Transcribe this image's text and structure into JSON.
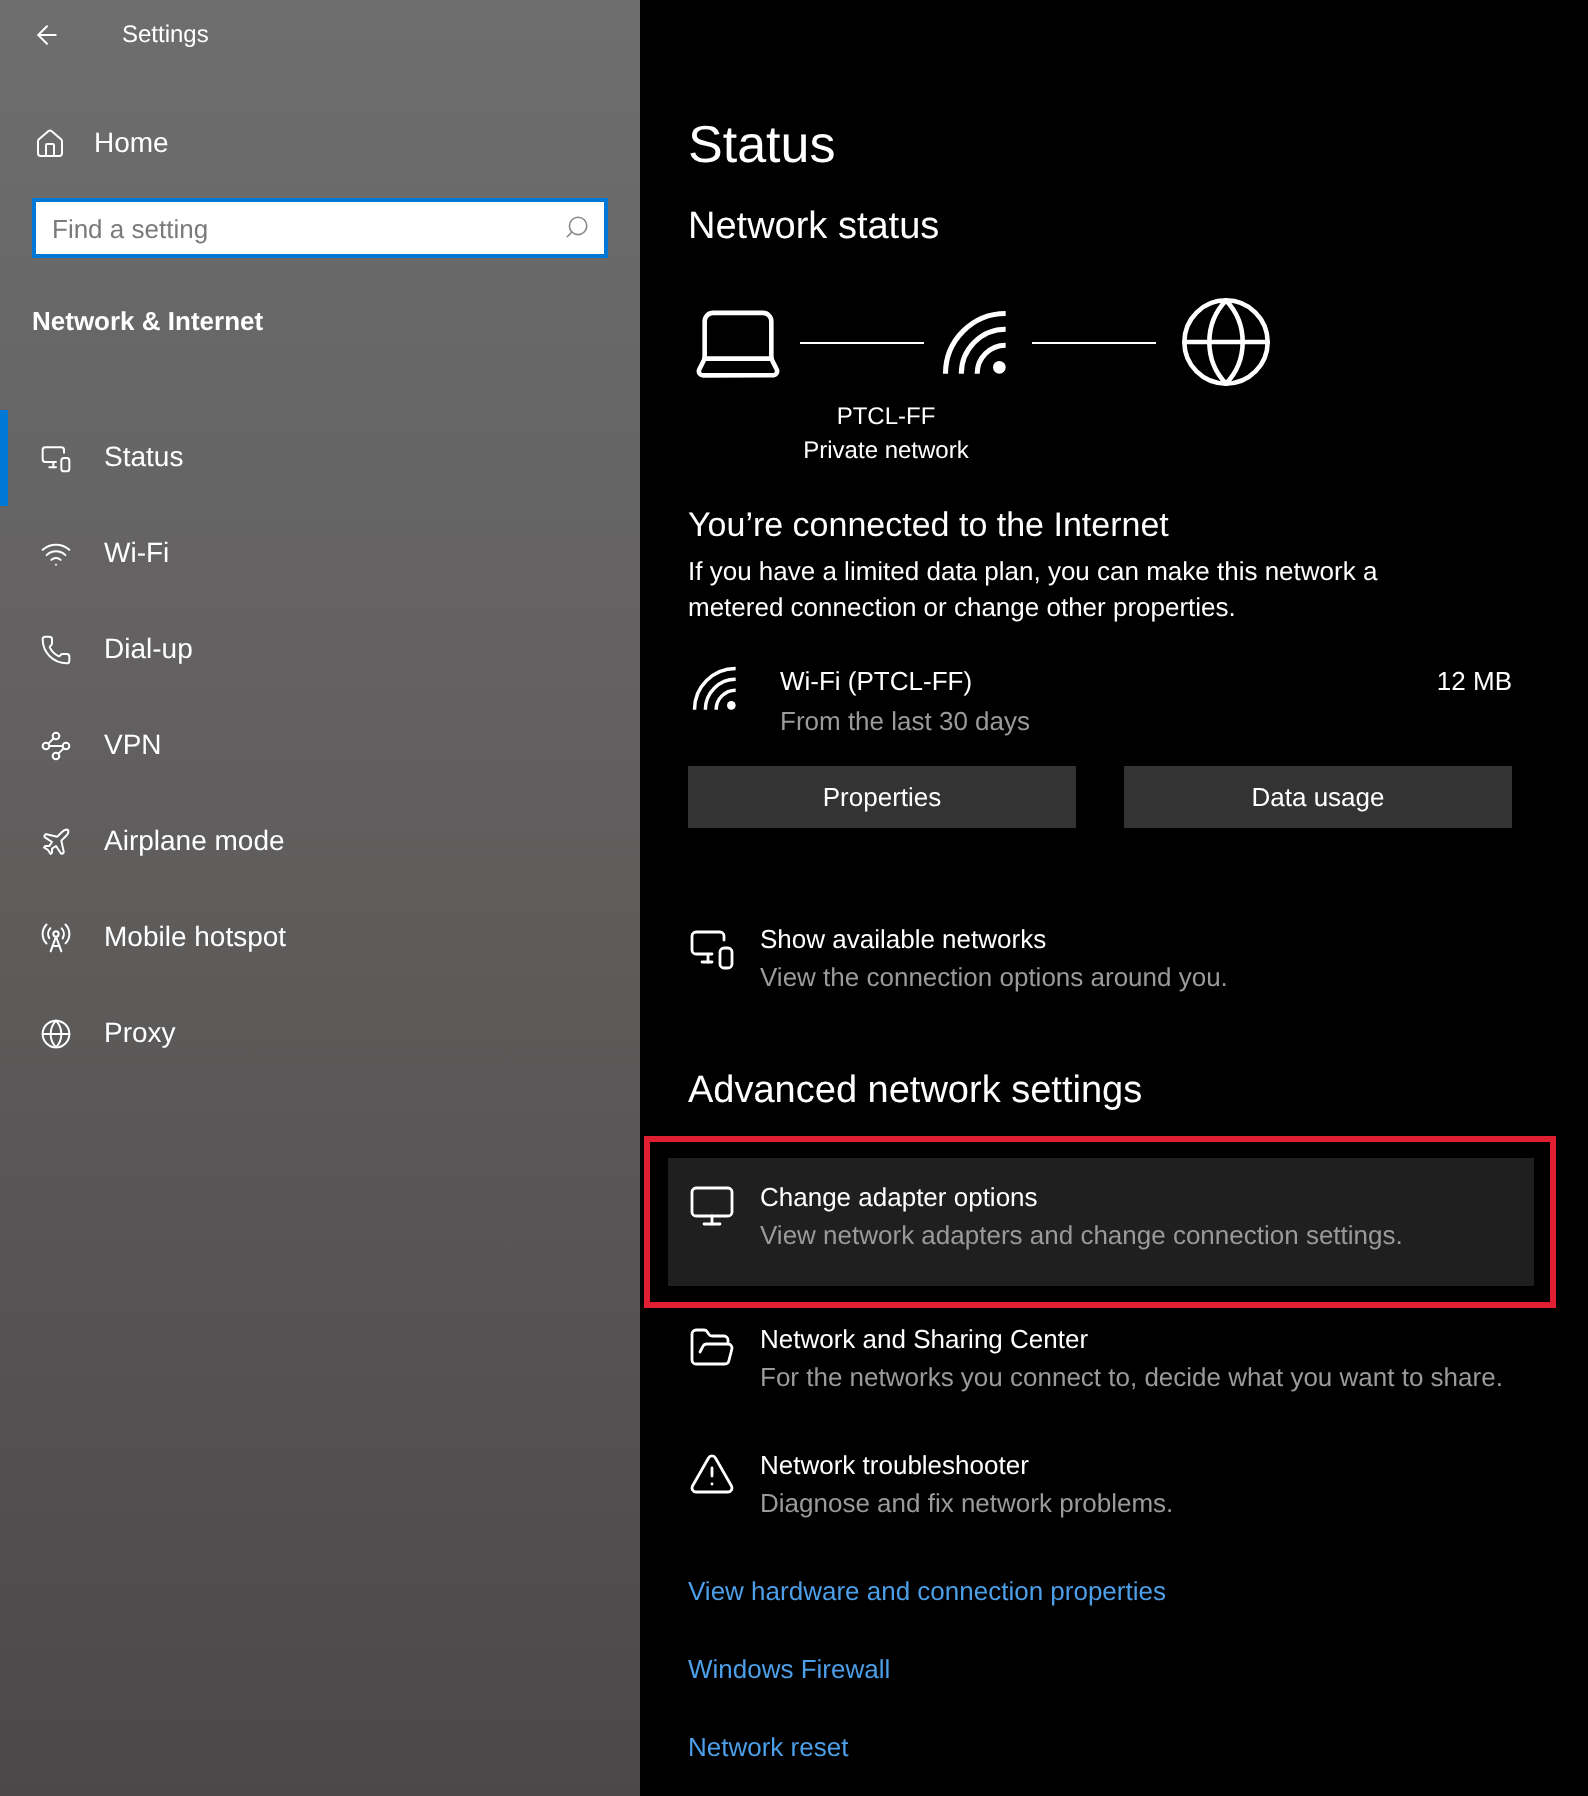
{
  "window": {
    "title": "Settings"
  },
  "sidebar": {
    "home": "Home",
    "search": {
      "placeholder": "Find a setting"
    },
    "section": "Network & Internet",
    "items": [
      {
        "label": "Status",
        "selected": true
      },
      {
        "label": "Wi-Fi",
        "selected": false
      },
      {
        "label": "Dial-up",
        "selected": false
      },
      {
        "label": "VPN",
        "selected": false
      },
      {
        "label": "Airplane mode",
        "selected": false
      },
      {
        "label": "Mobile hotspot",
        "selected": false
      },
      {
        "label": "Proxy",
        "selected": false
      }
    ]
  },
  "main": {
    "title": "Status",
    "network_status": "Network status",
    "network_name": "PTCL-FF",
    "network_type": "Private network",
    "connected_heading": "You’re connected to the Internet",
    "connected_text": "If you have a limited data plan, you can make this network a metered connection or change other properties.",
    "connection": {
      "name": "Wi-Fi (PTCL-FF)",
      "period": "From the last 30 days",
      "usage": "12 MB"
    },
    "buttons": [
      "Properties",
      "Data usage"
    ],
    "show_networks": {
      "title": "Show available networks",
      "subtitle": "View the connection options around you."
    },
    "advanced_heading": "Advanced network settings",
    "advanced_items": [
      {
        "title": "Change adapter options",
        "subtitle": "View network adapters and change connection settings.",
        "highlighted": true
      },
      {
        "title": "Network and Sharing Center",
        "subtitle": "For the networks you connect to, decide what you want to share.",
        "highlighted": false
      },
      {
        "title": "Network troubleshooter",
        "subtitle": "Diagnose and fix network problems.",
        "highlighted": false
      }
    ],
    "links": [
      "View hardware and connection properties",
      "Windows Firewall",
      "Network reset"
    ]
  }
}
